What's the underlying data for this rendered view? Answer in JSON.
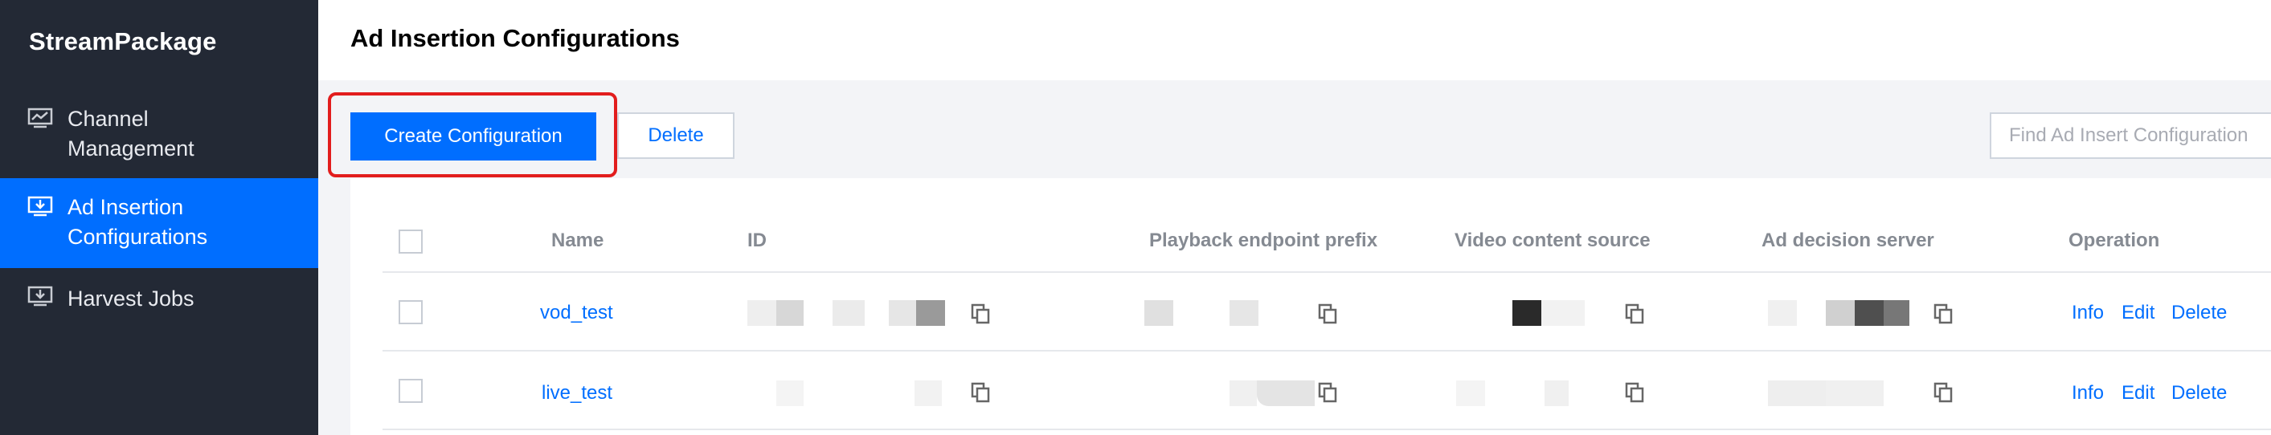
{
  "sidebar": {
    "brand": "StreamPackage",
    "items": [
      {
        "label_line1": "Channel",
        "label_line2": "Management",
        "icon": "chart-monitor-icon",
        "active": false
      },
      {
        "label_line1": "Ad Insertion",
        "label_line2": "Configurations",
        "icon": "download-monitor-icon",
        "active": true
      },
      {
        "label_line1": "Harvest Jobs",
        "label_line2": "",
        "icon": "download-box-icon",
        "active": false
      }
    ]
  },
  "header": {
    "title": "Ad Insertion Configurations"
  },
  "toolbar": {
    "create_label": "Create Configuration",
    "delete_label": "Delete",
    "search_placeholder": "Find Ad Insert Configuration"
  },
  "table": {
    "columns": [
      "Name",
      "ID",
      "Playback endpoint prefix",
      "Video content source",
      "Ad decision server",
      "Operation"
    ],
    "rows": [
      {
        "name": "vod_test",
        "actions": [
          "Info",
          "Edit",
          "Delete"
        ]
      },
      {
        "name": "live_test",
        "actions": [
          "Info",
          "Edit",
          "Delete"
        ]
      }
    ]
  },
  "colors": {
    "accent": "#006eff",
    "sidebar_bg": "#232935",
    "highlight": "#e21d1d"
  }
}
